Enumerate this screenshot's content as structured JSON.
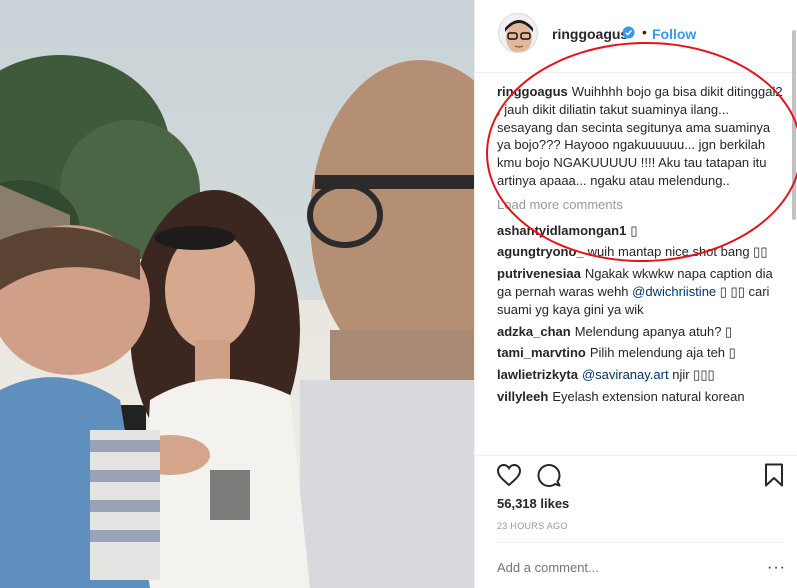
{
  "post": {
    "username": "ringgoagus",
    "follow_label": "Follow",
    "dot": "•",
    "caption": "Wuihhhh bojo ga bisa dikit ditinggal2 , jauh dikit diliatin takut suaminya ilang... sesayang dan secinta segitunya ama suaminya ya bojo??? Hayooo ngakuuuuuu... jgn berkilah kmu bojo NGAKUUUUU !!!! Aku tau tatapan itu artinya apaaa... ngaku atau melendung..",
    "load_more": "Load more comments",
    "likes": "56,318 likes",
    "time": "23 HOURS AGO",
    "add_comment_placeholder": "Add a comment...",
    "more_label": "···"
  },
  "comments": [
    {
      "user": "ashantyidlamongan1",
      "text": "▯"
    },
    {
      "user": "agungtryono_",
      "text": "wuih mantap nice shot bang ▯▯"
    },
    {
      "user": "putrivenesiaa",
      "text": "Ngakak wkwkw napa caption dia ga pernah waras wehh",
      "mention": "@dwichriistine",
      "text2": "▯ ▯▯ cari suami yg kaya gini ya wik"
    },
    {
      "user": "adzka_chan",
      "text": "Melendung apanya atuh? ▯"
    },
    {
      "user": "tami_marvtino",
      "text": "Pilih melendung aja teh ▯"
    },
    {
      "user": "lawlietrizkyta",
      "mention": "@saviranay.art",
      "text2": "njir ▯▯▯"
    },
    {
      "user": "villyleeh",
      "text": "Eyelash extension natural korean"
    }
  ],
  "colors": {
    "link": "#3897f0",
    "annotation": "#e3131b",
    "muted": "#999999",
    "text": "#262626"
  },
  "icons": [
    "verified-badge-icon",
    "heart-icon",
    "comment-icon",
    "bookmark-icon",
    "more-options-icon"
  ]
}
